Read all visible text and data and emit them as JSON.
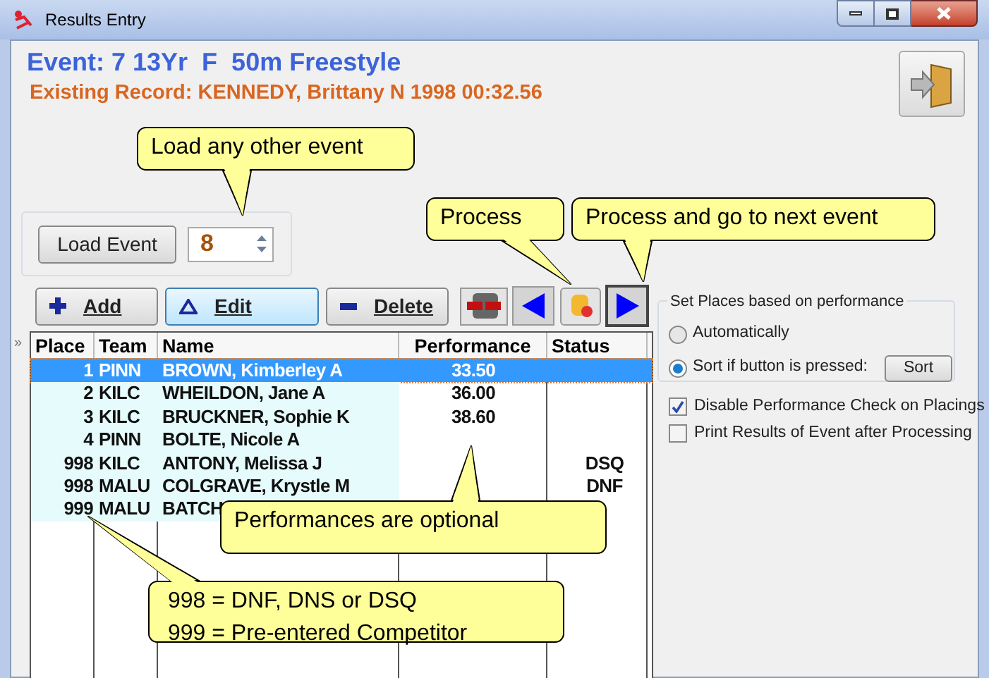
{
  "window": {
    "title": "Results Entry"
  },
  "event": {
    "title": "Event: 7 13Yr  F  50m Freestyle",
    "record": "Existing Record: KENNEDY, Brittany N 1998 00:32.56"
  },
  "load": {
    "button": "Load Event",
    "value": "8"
  },
  "toolbar": [
    {
      "kind": "add",
      "label": "Add"
    },
    {
      "kind": "edit",
      "label": "Edit"
    },
    {
      "kind": "delete",
      "label": "Delete"
    }
  ],
  "grid_expander": "»",
  "table": {
    "columns": [
      "Place",
      "Team",
      "Name",
      "Performance",
      "Status"
    ],
    "rows": [
      {
        "place": "1",
        "team": "PINN",
        "name": "BROWN, Kimberley A",
        "performance": "33.50",
        "status": "",
        "selected": true
      },
      {
        "place": "2",
        "team": "KILC",
        "name": "WHEILDON, Jane A",
        "performance": "36.00",
        "status": "",
        "selected": false
      },
      {
        "place": "3",
        "team": "KILC",
        "name": "BRUCKNER, Sophie K",
        "performance": "38.60",
        "status": "",
        "selected": false
      },
      {
        "place": "4",
        "team": "PINN",
        "name": "BOLTE, Nicole A",
        "performance": "",
        "status": "",
        "selected": false
      },
      {
        "place": "998",
        "team": "KILC",
        "name": "ANTONY, Melissa J",
        "performance": "",
        "status": "DSQ",
        "selected": false
      },
      {
        "place": "998",
        "team": "MALU",
        "name": "COLGRAVE, Krystle M",
        "performance": "",
        "status": "DNF",
        "selected": false
      },
      {
        "place": "999",
        "team": "MALU",
        "name": "BATCH",
        "performance": "",
        "status": "",
        "selected": false
      }
    ]
  },
  "places": {
    "title": "Set Places based on performance",
    "options": [
      {
        "label": "Automatically",
        "selected": false
      },
      {
        "label": "Sort if button is pressed:",
        "selected": true
      }
    ],
    "sort_button": "Sort"
  },
  "options": [
    {
      "label": "Disable Performance Check on Placings",
      "checked": true
    },
    {
      "label": "Print Results of Event after Processing",
      "checked": false
    }
  ],
  "callouts": [
    "Load any other event",
    "Process",
    "Process and go to next event",
    "Performances are optional",
    "998 = DNF, DNS or DSQ\n999 = Pre-entered Competitor"
  ]
}
